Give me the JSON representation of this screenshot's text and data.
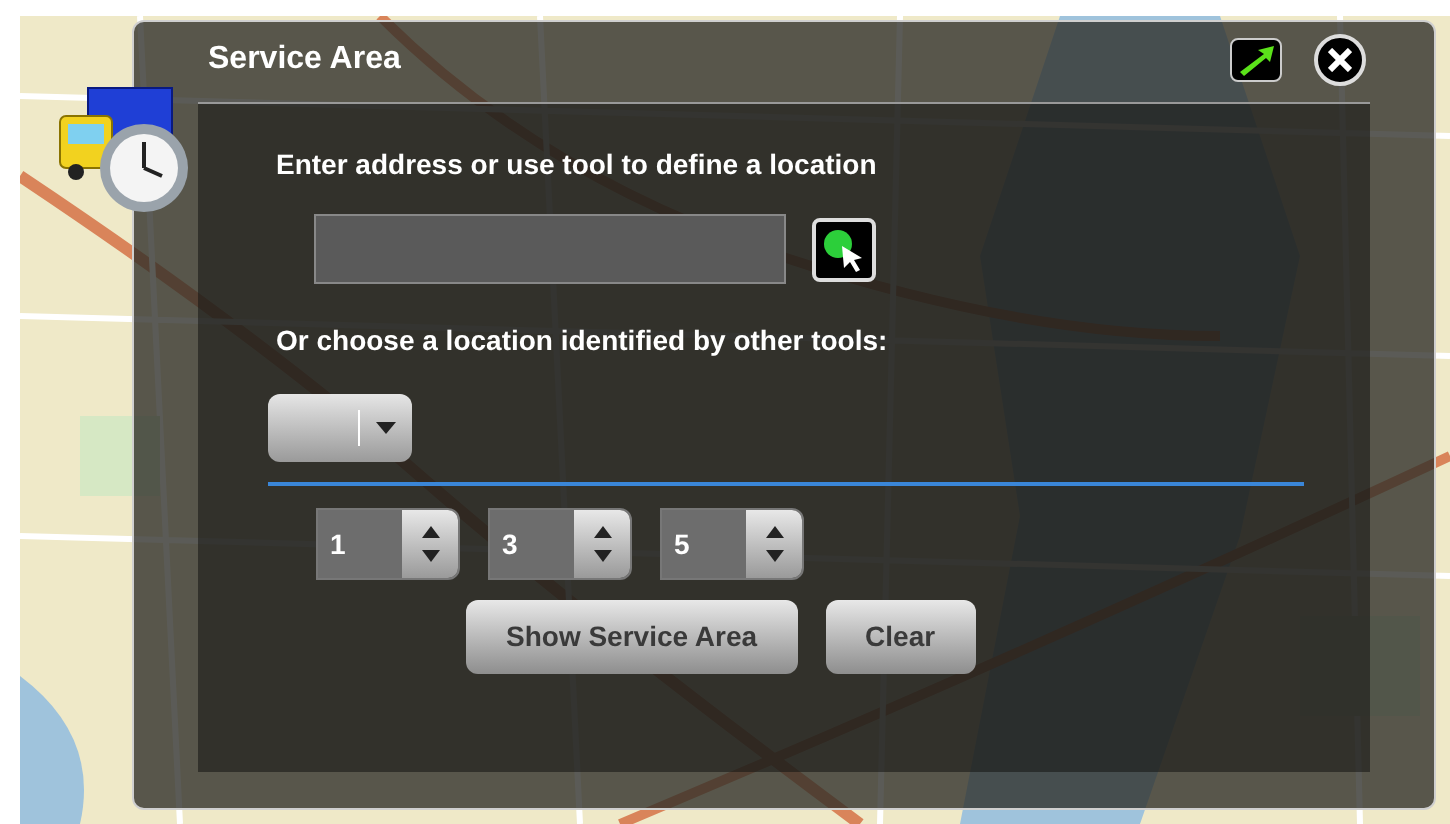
{
  "map": {
    "kind": "picture"
  },
  "panel": {
    "title": "Service Area"
  },
  "address": {
    "prompt": "Enter address or use tool to define a location"
  },
  "other_tools": {
    "prompt": "Or choose a location identified by other tools:"
  },
  "break_values": [
    "1",
    "3",
    "5"
  ],
  "buttons": [
    "Show Service Area",
    "Clear"
  ]
}
